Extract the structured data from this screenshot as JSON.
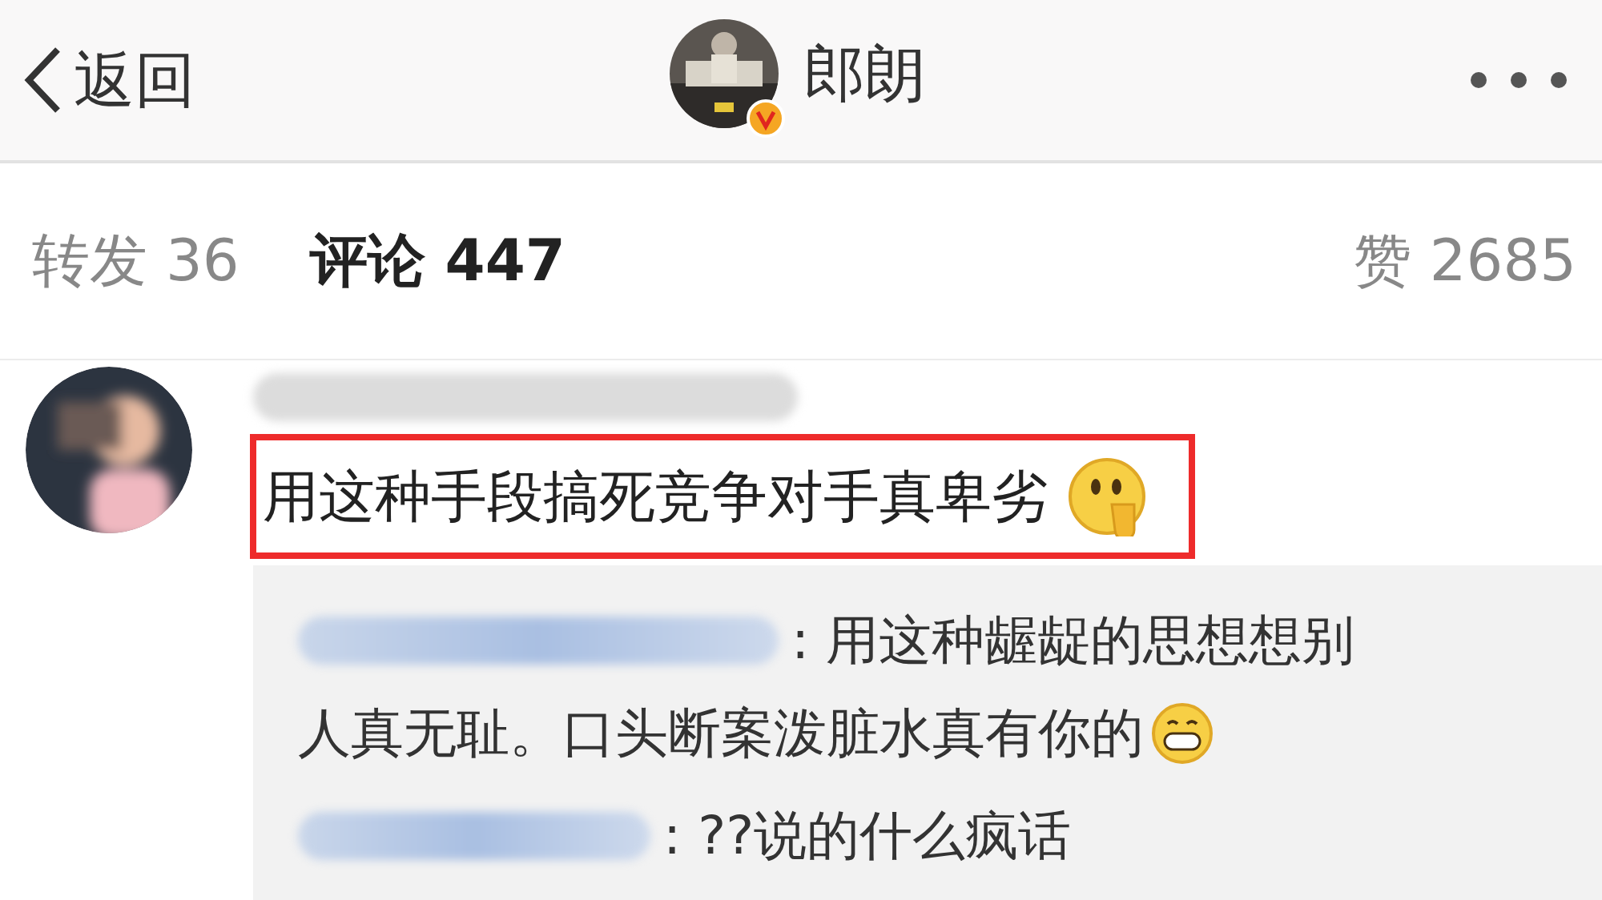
{
  "header": {
    "back_label": "返回",
    "title": "郎朗",
    "verified": true
  },
  "tabs": [
    {
      "label": "转发 36",
      "selected": false
    },
    {
      "label": "评论 447",
      "selected": true
    },
    {
      "label": "赞 2685",
      "selected": false
    }
  ],
  "comment": {
    "text": "用这种手段搞死竞争对手真卑劣",
    "highlighted": true,
    "kind": "thinking"
  },
  "replies": [
    {
      "lines": [
        ": 用这种龌龊的思想想别",
        "人真无耻。口头断案泼脏水真有你的"
      ],
      "kind": "grin"
    },
    {
      "lines": [
        ": ??说的什么疯话"
      ],
      "kind": "plain"
    }
  ]
}
